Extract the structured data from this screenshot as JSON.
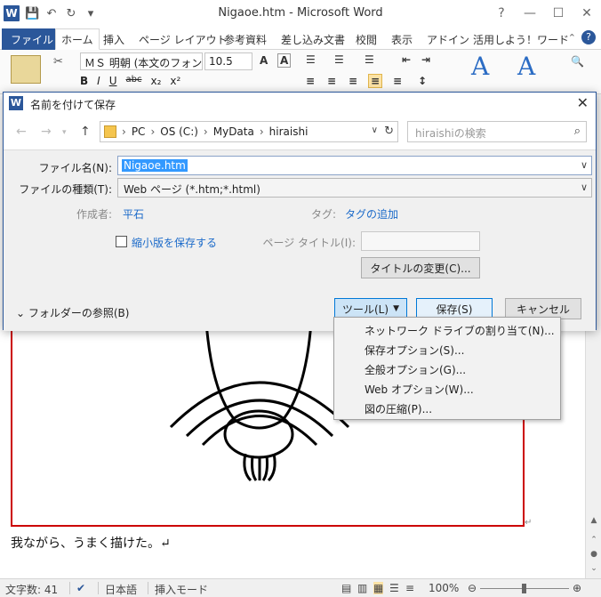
{
  "window": {
    "title": "Nigaoe.htm  -  Microsoft Word",
    "word_logo": "W"
  },
  "tabs": [
    "ファイル",
    "ホーム",
    "挿入",
    "ページ レイアウト",
    "参考資料",
    "差し込み文書",
    "校閲",
    "表示",
    "アドイン",
    "活用しよう！ワード"
  ],
  "ribbon": {
    "font_name": "ＭＳ 明朝 (本文のフォン",
    "font_size": "10.5",
    "bold": "B",
    "italic": "I",
    "underline": "U",
    "strike": "abc",
    "sub": "x₂",
    "sup": "x²"
  },
  "document": {
    "text": "我ながら、うまく描けた。↵"
  },
  "status": {
    "word_count": "文字数: 41",
    "language": "日本語",
    "mode": "挿入モード",
    "zoom": "100%"
  },
  "dialog": {
    "title": "名前を付けて保存",
    "breadcrumbs": [
      "PC",
      "OS (C:)",
      "MyData",
      "hiraishi"
    ],
    "search_placeholder": "hiraishiの検索",
    "filename_label": "ファイル名(N):",
    "filename_value": "Nigaoe.htm",
    "filetype_label": "ファイルの種類(T):",
    "filetype_value": "Web ページ (*.htm;*.html)",
    "author_label": "作成者:",
    "author_value": "平石",
    "tag_label": "タグ:",
    "tag_value": "タグの追加",
    "thumbnail_label": "縮小版を保存する",
    "page_title_label": "ページ タイトル(I):",
    "change_title_button": "タイトルの変更(C)...",
    "browse_folders": "フォルダーの参照(B)",
    "tools_button": "ツール(L)",
    "save_button": "保存(S)",
    "cancel_button": "キャンセル"
  },
  "tools_menu": [
    "ネットワーク ドライブの割り当て(N)...",
    "保存オプション(S)...",
    "全般オプション(G)...",
    "Web オプション(W)...",
    "図の圧縮(P)..."
  ]
}
